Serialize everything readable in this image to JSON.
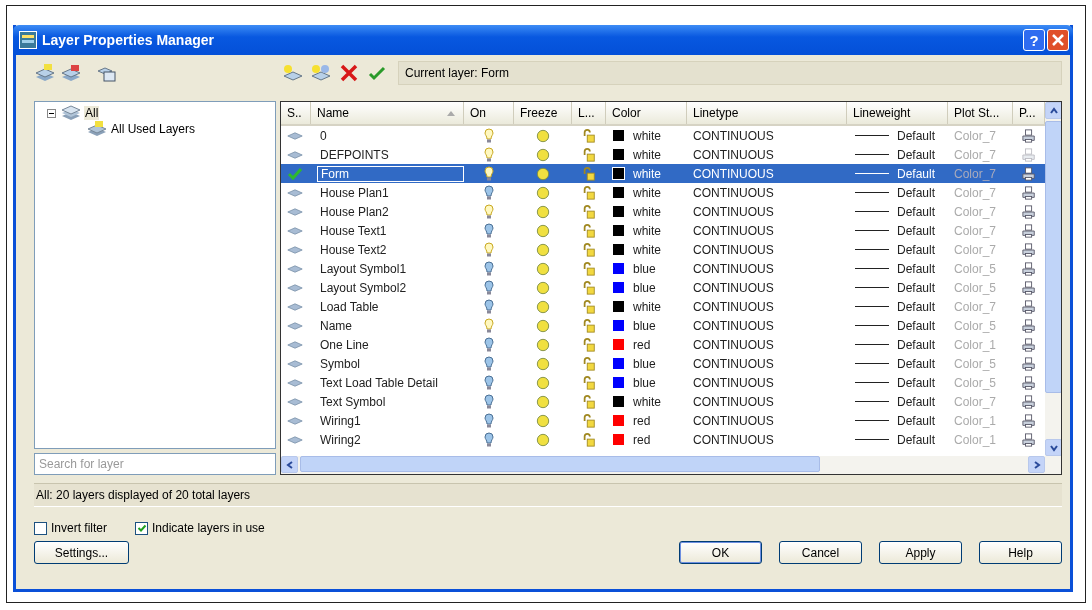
{
  "window": {
    "title": "Layer Properties Manager",
    "help": "?"
  },
  "current_layer": "Current layer: Form",
  "tree": {
    "label": "All",
    "expanded": true,
    "children": [
      {
        "label": "All Used Layers"
      }
    ]
  },
  "search": {
    "placeholder": "Search for layer"
  },
  "table": {
    "columns": [
      "S..",
      "Name",
      "On",
      "Freeze",
      "L...",
      "Color",
      "Linetype",
      "Lineweight",
      "Plot St...",
      "P..."
    ],
    "rows": [
      {
        "current": false,
        "selected": false,
        "name": "0",
        "on": true,
        "color": "#000000",
        "color_name": "white",
        "linetype": "CONTINUOUS",
        "lineweight": "Default",
        "plot_style": "Color_7",
        "plot": true
      },
      {
        "current": false,
        "selected": false,
        "name": "DEFPOINTS",
        "on": true,
        "color": "#000000",
        "color_name": "white",
        "linetype": "CONTINUOUS",
        "lineweight": "Default",
        "plot_style": "Color_7",
        "plot": false
      },
      {
        "current": true,
        "selected": true,
        "name": "Form",
        "on": true,
        "color": "#000000",
        "color_name": "white",
        "linetype": "CONTINUOUS",
        "lineweight": "Default",
        "plot_style": "Color_7",
        "plot": true
      },
      {
        "current": false,
        "selected": false,
        "name": "House Plan1",
        "on": false,
        "color": "#000000",
        "color_name": "white",
        "linetype": "CONTINUOUS",
        "lineweight": "Default",
        "plot_style": "Color_7",
        "plot": true
      },
      {
        "current": false,
        "selected": false,
        "name": "House Plan2",
        "on": true,
        "color": "#000000",
        "color_name": "white",
        "linetype": "CONTINUOUS",
        "lineweight": "Default",
        "plot_style": "Color_7",
        "plot": true
      },
      {
        "current": false,
        "selected": false,
        "name": "House Text1",
        "on": false,
        "color": "#000000",
        "color_name": "white",
        "linetype": "CONTINUOUS",
        "lineweight": "Default",
        "plot_style": "Color_7",
        "plot": true
      },
      {
        "current": false,
        "selected": false,
        "name": "House Text2",
        "on": true,
        "color": "#000000",
        "color_name": "white",
        "linetype": "CONTINUOUS",
        "lineweight": "Default",
        "plot_style": "Color_7",
        "plot": true
      },
      {
        "current": false,
        "selected": false,
        "name": "Layout Symbol1",
        "on": false,
        "color": "#0000ff",
        "color_name": "blue",
        "linetype": "CONTINUOUS",
        "lineweight": "Default",
        "plot_style": "Color_5",
        "plot": true
      },
      {
        "current": false,
        "selected": false,
        "name": "Layout Symbol2",
        "on": false,
        "color": "#0000ff",
        "color_name": "blue",
        "linetype": "CONTINUOUS",
        "lineweight": "Default",
        "plot_style": "Color_5",
        "plot": true
      },
      {
        "current": false,
        "selected": false,
        "name": "Load Table",
        "on": false,
        "color": "#000000",
        "color_name": "white",
        "linetype": "CONTINUOUS",
        "lineweight": "Default",
        "plot_style": "Color_7",
        "plot": true
      },
      {
        "current": false,
        "selected": false,
        "name": "Name",
        "on": true,
        "color": "#0000ff",
        "color_name": "blue",
        "linetype": "CONTINUOUS",
        "lineweight": "Default",
        "plot_style": "Color_5",
        "plot": true
      },
      {
        "current": false,
        "selected": false,
        "name": "One Line",
        "on": false,
        "color": "#ff0000",
        "color_name": "red",
        "linetype": "CONTINUOUS",
        "lineweight": "Default",
        "plot_style": "Color_1",
        "plot": true
      },
      {
        "current": false,
        "selected": false,
        "name": "Symbol",
        "on": false,
        "color": "#0000ff",
        "color_name": "blue",
        "linetype": "CONTINUOUS",
        "lineweight": "Default",
        "plot_style": "Color_5",
        "plot": true
      },
      {
        "current": false,
        "selected": false,
        "name": "Text Load Table Detail",
        "on": false,
        "color": "#0000ff",
        "color_name": "blue",
        "linetype": "CONTINUOUS",
        "lineweight": "Default",
        "plot_style": "Color_5",
        "plot": true
      },
      {
        "current": false,
        "selected": false,
        "name": "Text Symbol",
        "on": false,
        "color": "#000000",
        "color_name": "white",
        "linetype": "CONTINUOUS",
        "lineweight": "Default",
        "plot_style": "Color_7",
        "plot": true
      },
      {
        "current": false,
        "selected": false,
        "name": "Wiring1",
        "on": false,
        "color": "#ff0000",
        "color_name": "red",
        "linetype": "CONTINUOUS",
        "lineweight": "Default",
        "plot_style": "Color_1",
        "plot": true
      },
      {
        "current": false,
        "selected": false,
        "name": "Wiring2",
        "on": false,
        "color": "#ff0000",
        "color_name": "red",
        "linetype": "CONTINUOUS",
        "lineweight": "Default",
        "plot_style": "Color_1",
        "plot": true
      }
    ]
  },
  "status": "All: 20 layers displayed of 20 total layers",
  "options": [
    {
      "label": "Invert filter",
      "checked": false
    },
    {
      "label": "Indicate layers in use",
      "checked": true
    }
  ],
  "buttons": [
    "Settings...",
    "OK",
    "Cancel",
    "Apply",
    "Help"
  ]
}
